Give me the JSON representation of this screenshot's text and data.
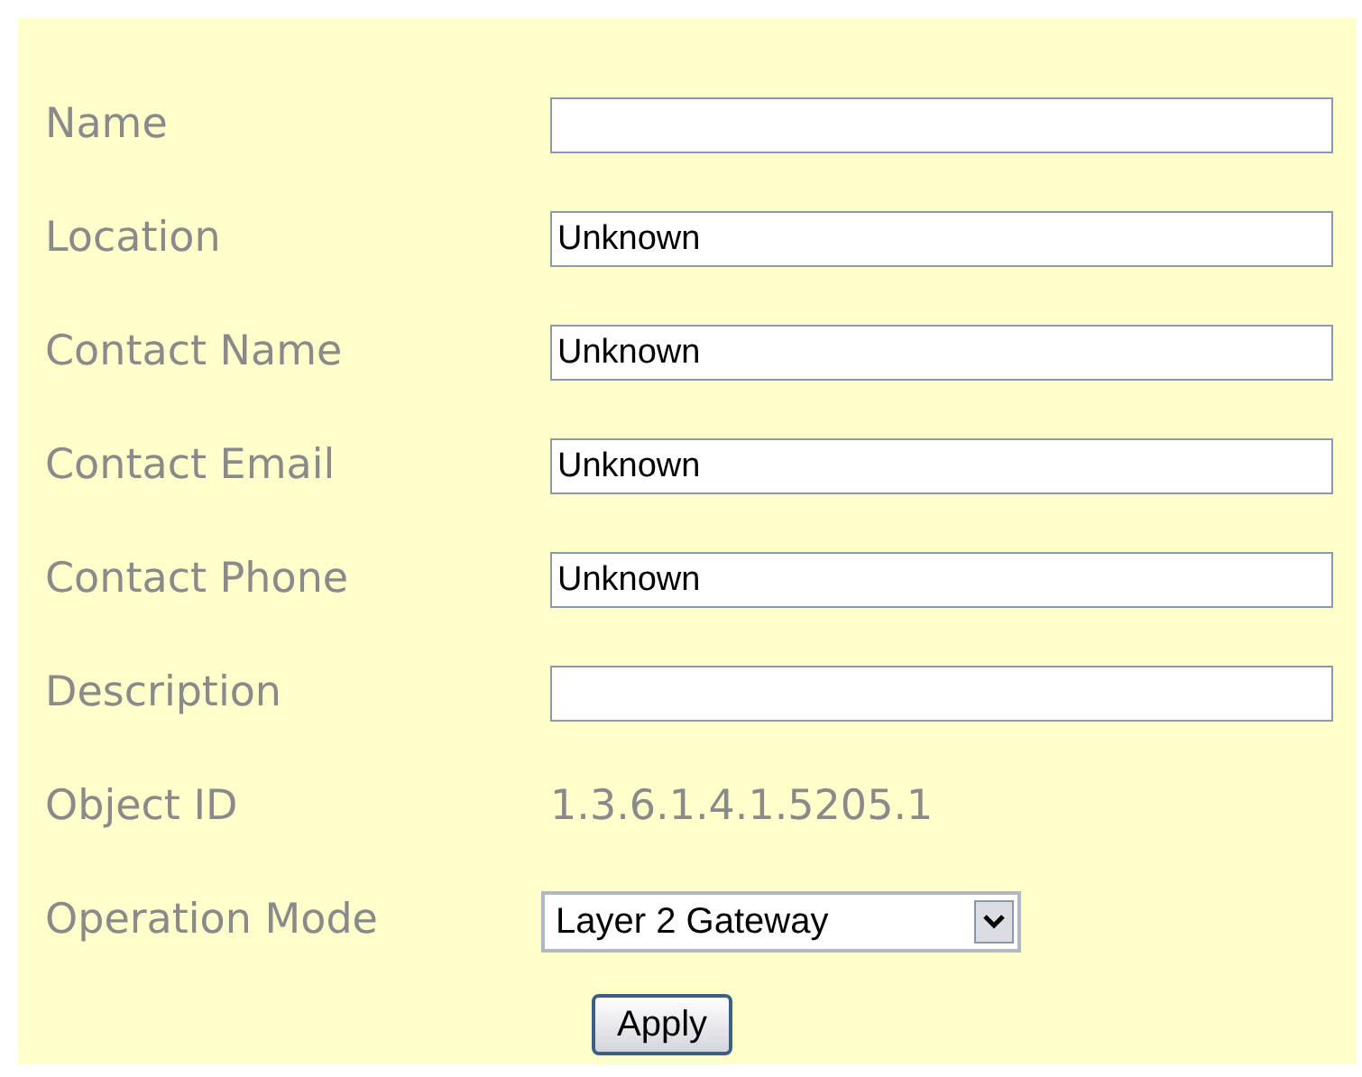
{
  "fields": [
    {
      "label": "Name",
      "kind": "input"
    },
    {
      "label": "Location",
      "kind": "input",
      "value": "Unknown"
    },
    {
      "label": "Contact Name",
      "kind": "input",
      "value": "Unknown"
    },
    {
      "label": "Contact Email",
      "kind": "input",
      "value": "Unknown"
    },
    {
      "label": "Contact Phone",
      "kind": "input",
      "value": "Unknown"
    },
    {
      "label": "Description",
      "kind": "input"
    },
    {
      "label": "Object ID",
      "kind": "text",
      "value": "1.3.6.1.4.1.5205.1"
    },
    {
      "label": "Operation Mode",
      "kind": "select",
      "value": "Layer 2 Gateway"
    }
  ],
  "button": "Apply"
}
